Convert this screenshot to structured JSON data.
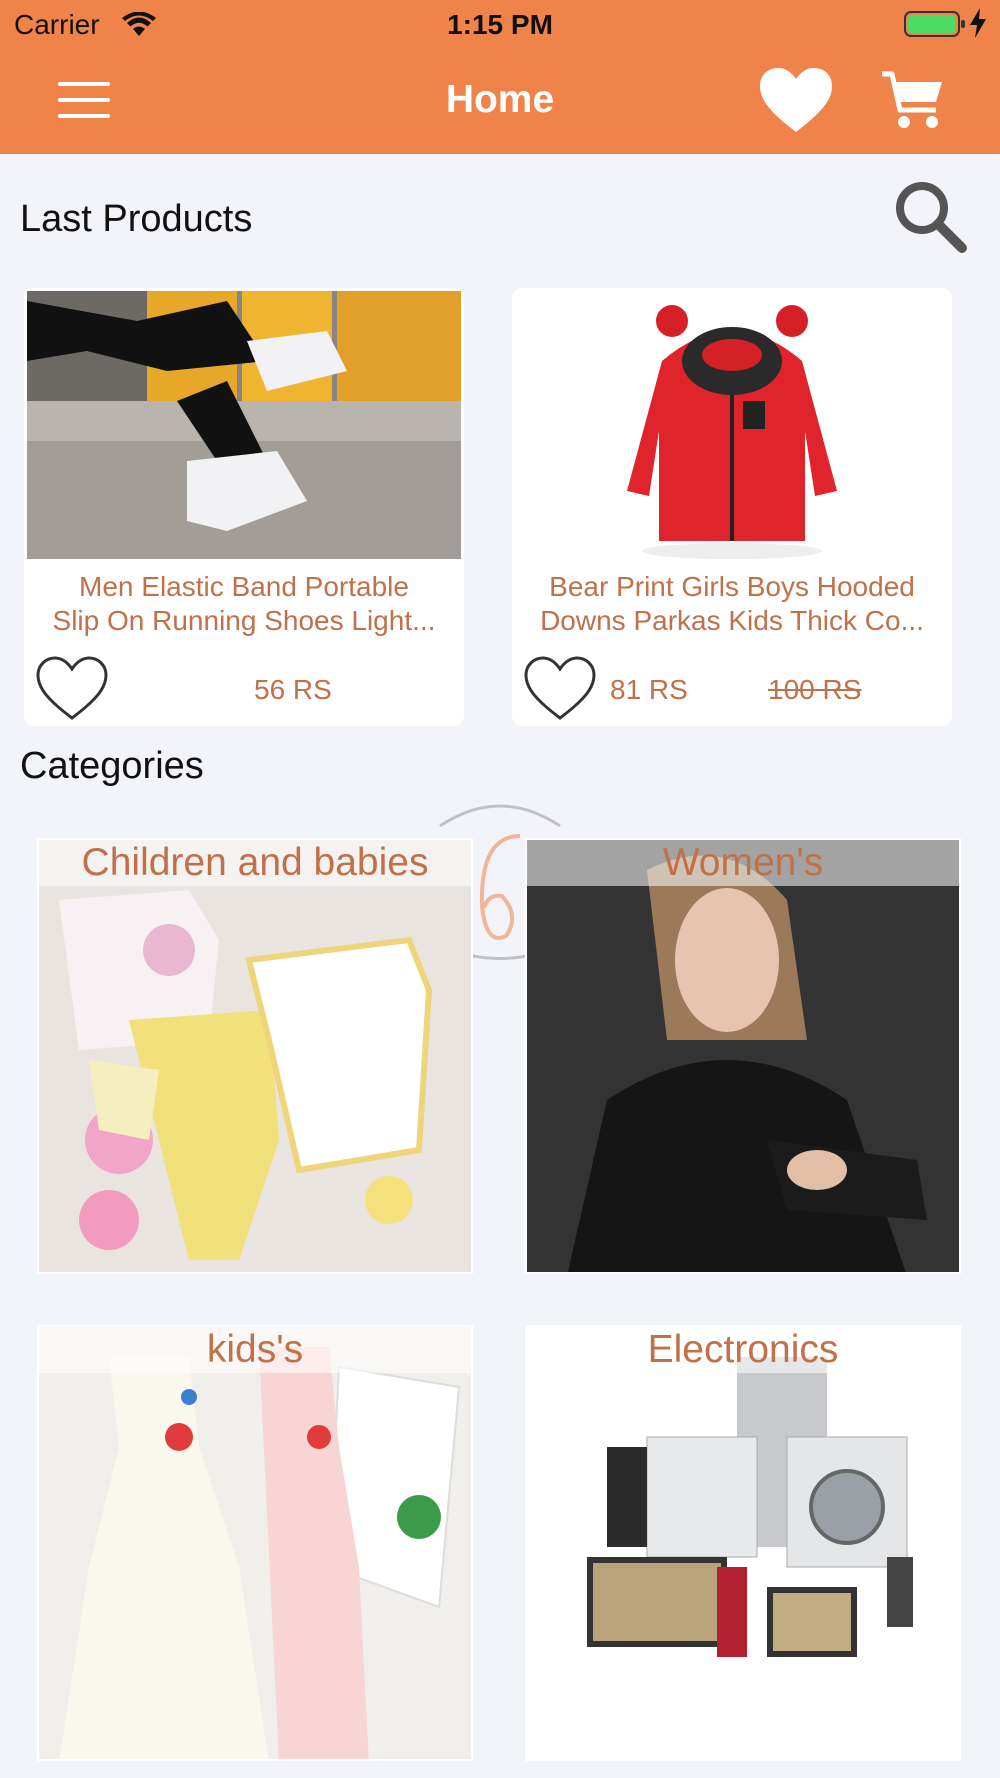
{
  "status_bar": {
    "carrier": "Carrier",
    "time": "1:15 PM"
  },
  "nav": {
    "title": "Home",
    "icons": [
      "menu-icon",
      "heart-icon",
      "cart-icon"
    ]
  },
  "last_products": {
    "title": "Last Products",
    "search_icon": "search-icon",
    "items": [
      {
        "name_line1": "Men Elastic Band Portable",
        "name_line2": "Slip On Running Shoes Light...",
        "price": "56 RS",
        "old_price": ""
      },
      {
        "name_line1": "Bear Print Girls Boys Hooded",
        "name_line2": "Downs Parkas Kids Thick Co...",
        "price": "81 RS",
        "old_price": "100 RS"
      }
    ]
  },
  "categories": {
    "title": "Categories",
    "items": [
      {
        "label": "Children and babies"
      },
      {
        "label": "Women's"
      },
      {
        "label": "kids's"
      },
      {
        "label": "Electronics"
      }
    ]
  },
  "colors": {
    "accent": "#f0834a",
    "price_text": "#c0714a",
    "background": "#f3f4f9"
  }
}
